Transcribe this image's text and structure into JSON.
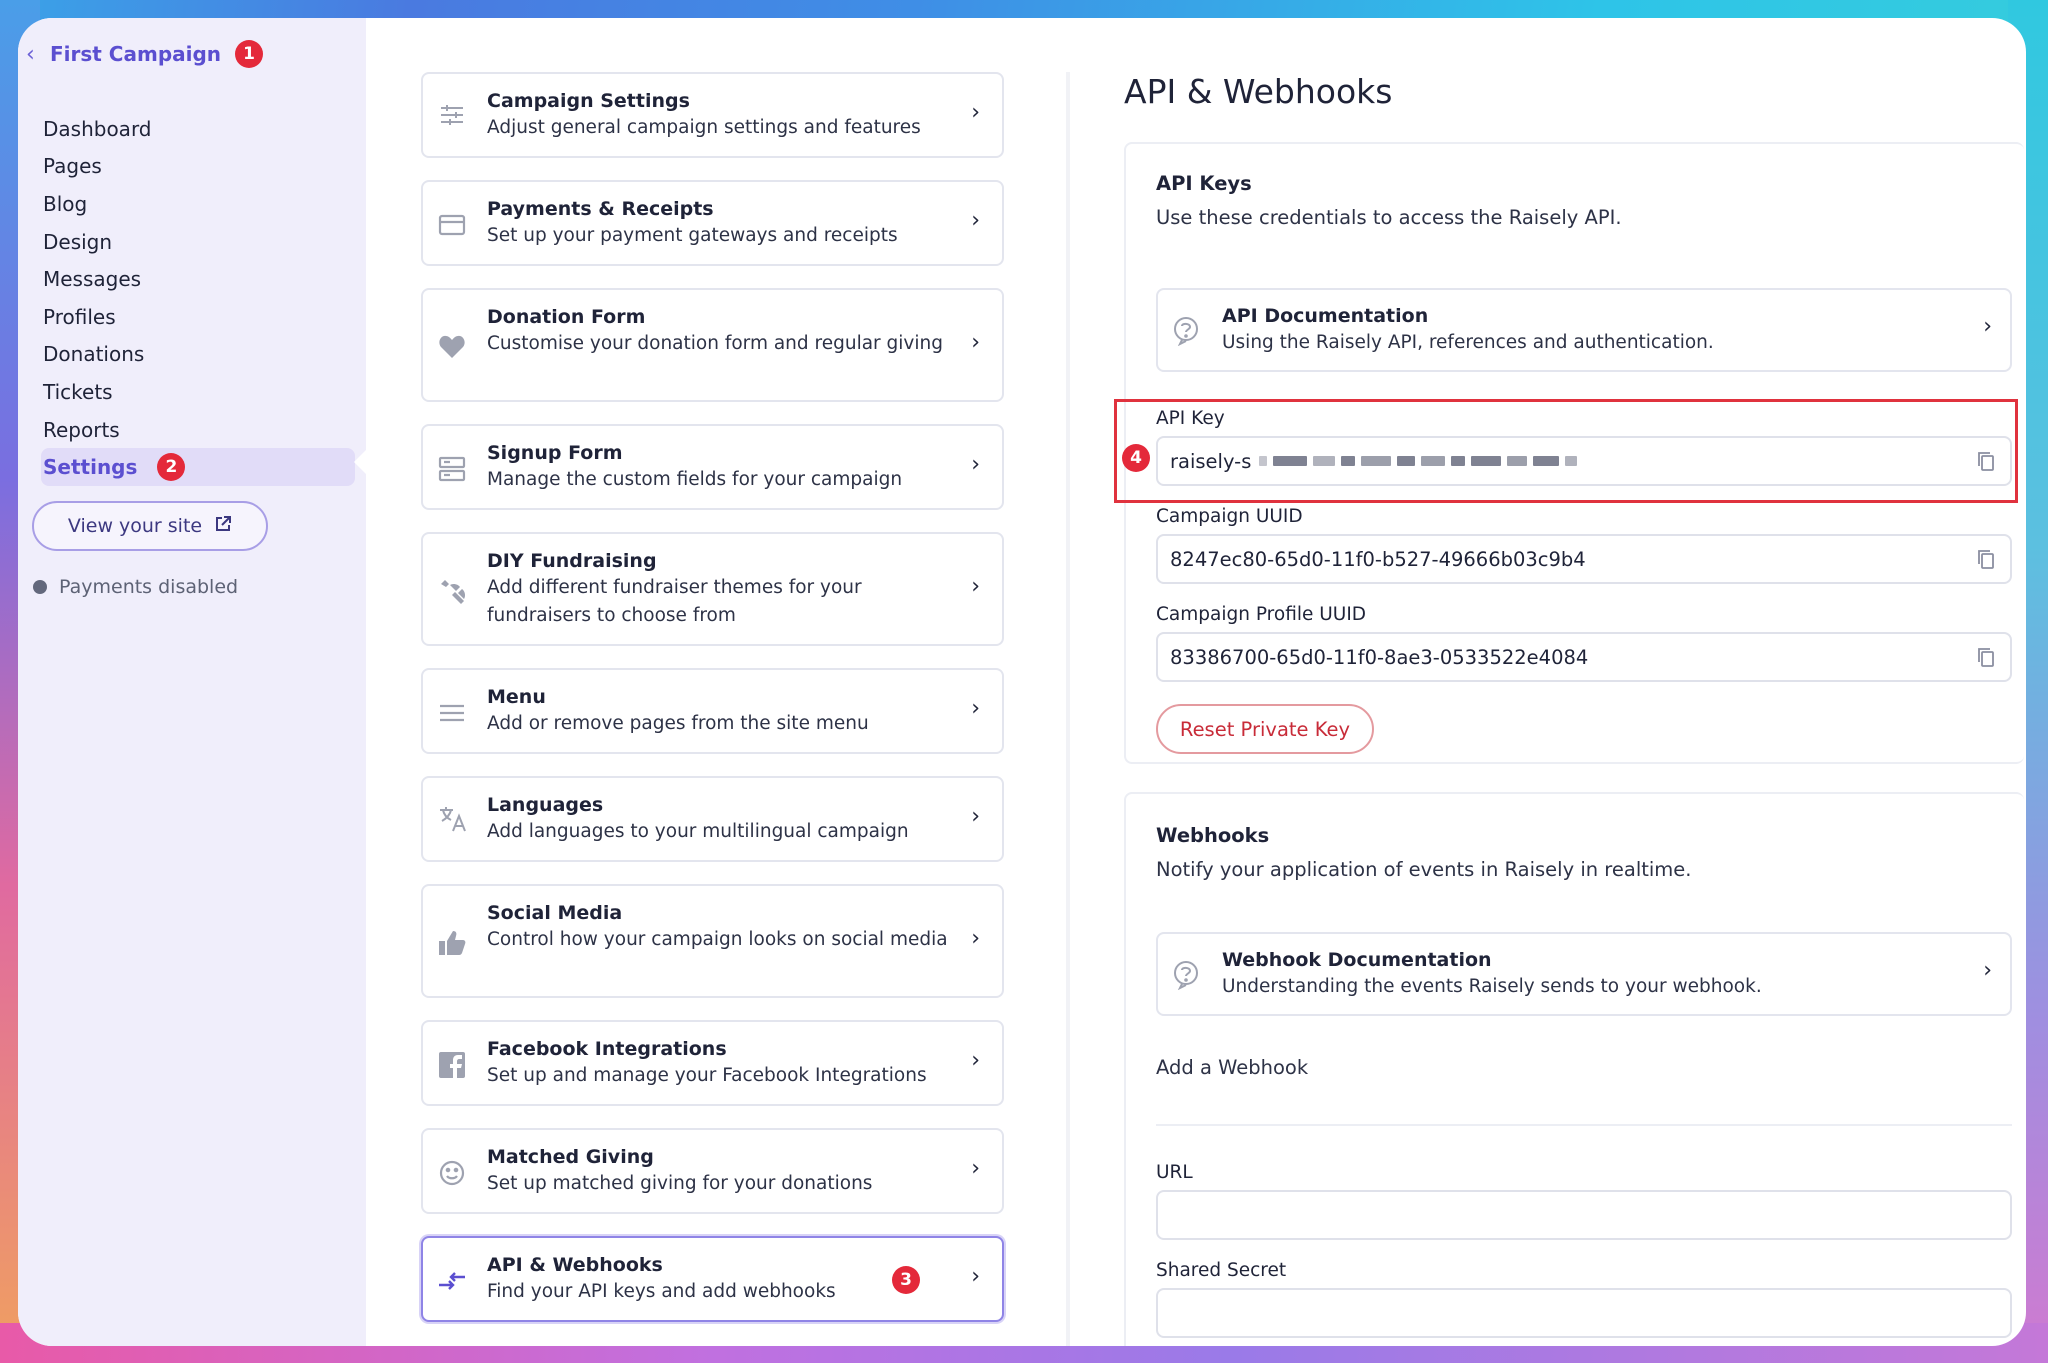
{
  "sidebar": {
    "campaign_title": "First Campaign",
    "campaign_badge": "1",
    "items": [
      {
        "label": "Dashboard"
      },
      {
        "label": "Pages"
      },
      {
        "label": "Blog"
      },
      {
        "label": "Design"
      },
      {
        "label": "Messages"
      },
      {
        "label": "Profiles"
      },
      {
        "label": "Donations"
      },
      {
        "label": "Tickets"
      },
      {
        "label": "Reports"
      },
      {
        "label": "Settings",
        "badge": "2",
        "active": true
      }
    ],
    "view_site_label": "View your site",
    "payments_status": "Payments disabled"
  },
  "settings_cards": [
    {
      "title": "Campaign Settings",
      "desc": "Adjust general campaign settings and features",
      "icon": "sliders-icon"
    },
    {
      "title": "Payments & Receipts",
      "desc": "Set up your payment gateways and receipts",
      "icon": "credit-card-icon"
    },
    {
      "title": "Donation Form",
      "desc": "Customise your donation form and regular giving",
      "icon": "heart-icon"
    },
    {
      "title": "Signup Form",
      "desc": "Manage the custom fields for your campaign",
      "icon": "form-icon"
    },
    {
      "title": "DIY Fundraising",
      "desc": "Add different fundraiser themes for your fundraisers to choose from",
      "icon": "wrench-icon"
    },
    {
      "title": "Menu",
      "desc": "Add or remove pages from the site menu",
      "icon": "menu-icon"
    },
    {
      "title": "Languages",
      "desc": "Add languages to your multilingual campaign",
      "icon": "translate-icon"
    },
    {
      "title": "Social Media",
      "desc": "Control how your campaign looks on social media",
      "icon": "thumbs-up-icon"
    },
    {
      "title": "Facebook Integrations",
      "desc": "Set up and manage your Facebook Integrations",
      "icon": "facebook-icon"
    },
    {
      "title": "Matched Giving",
      "desc": "Set up matched giving for your donations",
      "icon": "smiley-icon"
    },
    {
      "title": "API & Webhooks",
      "desc": "Find your API keys and add webhooks",
      "icon": "swap-arrows-icon",
      "badge": "3",
      "active": true
    }
  ],
  "main": {
    "page_title": "API & Webhooks",
    "api_keys": {
      "title": "API Keys",
      "desc": "Use these credentials to access the Raisely API.",
      "doc_title": "API Documentation",
      "doc_desc": "Using the Raisely API, references and authentication.",
      "api_key_label": "API Key",
      "api_key_value": "raisely-s",
      "api_key_badge": "4",
      "uuid_label": "Campaign UUID",
      "uuid_value": "8247ec80-65d0-11f0-b527-49666b03c9b4",
      "profile_uuid_label": "Campaign Profile UUID",
      "profile_uuid_value": "83386700-65d0-11f0-8ae3-0533522e4084",
      "reset_label": "Reset Private Key"
    },
    "webhooks": {
      "title": "Webhooks",
      "desc": "Notify your application of events in Raisely in realtime.",
      "doc_title": "Webhook Documentation",
      "doc_desc": "Understanding the events Raisely sends to your webhook.",
      "add_title": "Add a Webhook",
      "url_label": "URL",
      "url_value": "",
      "secret_label": "Shared Secret",
      "secret_value": ""
    }
  },
  "colors": {
    "accent": "#5b4fd0",
    "badge": "#e4293a",
    "highlight": "#e0323e",
    "danger": "#c82b38"
  }
}
